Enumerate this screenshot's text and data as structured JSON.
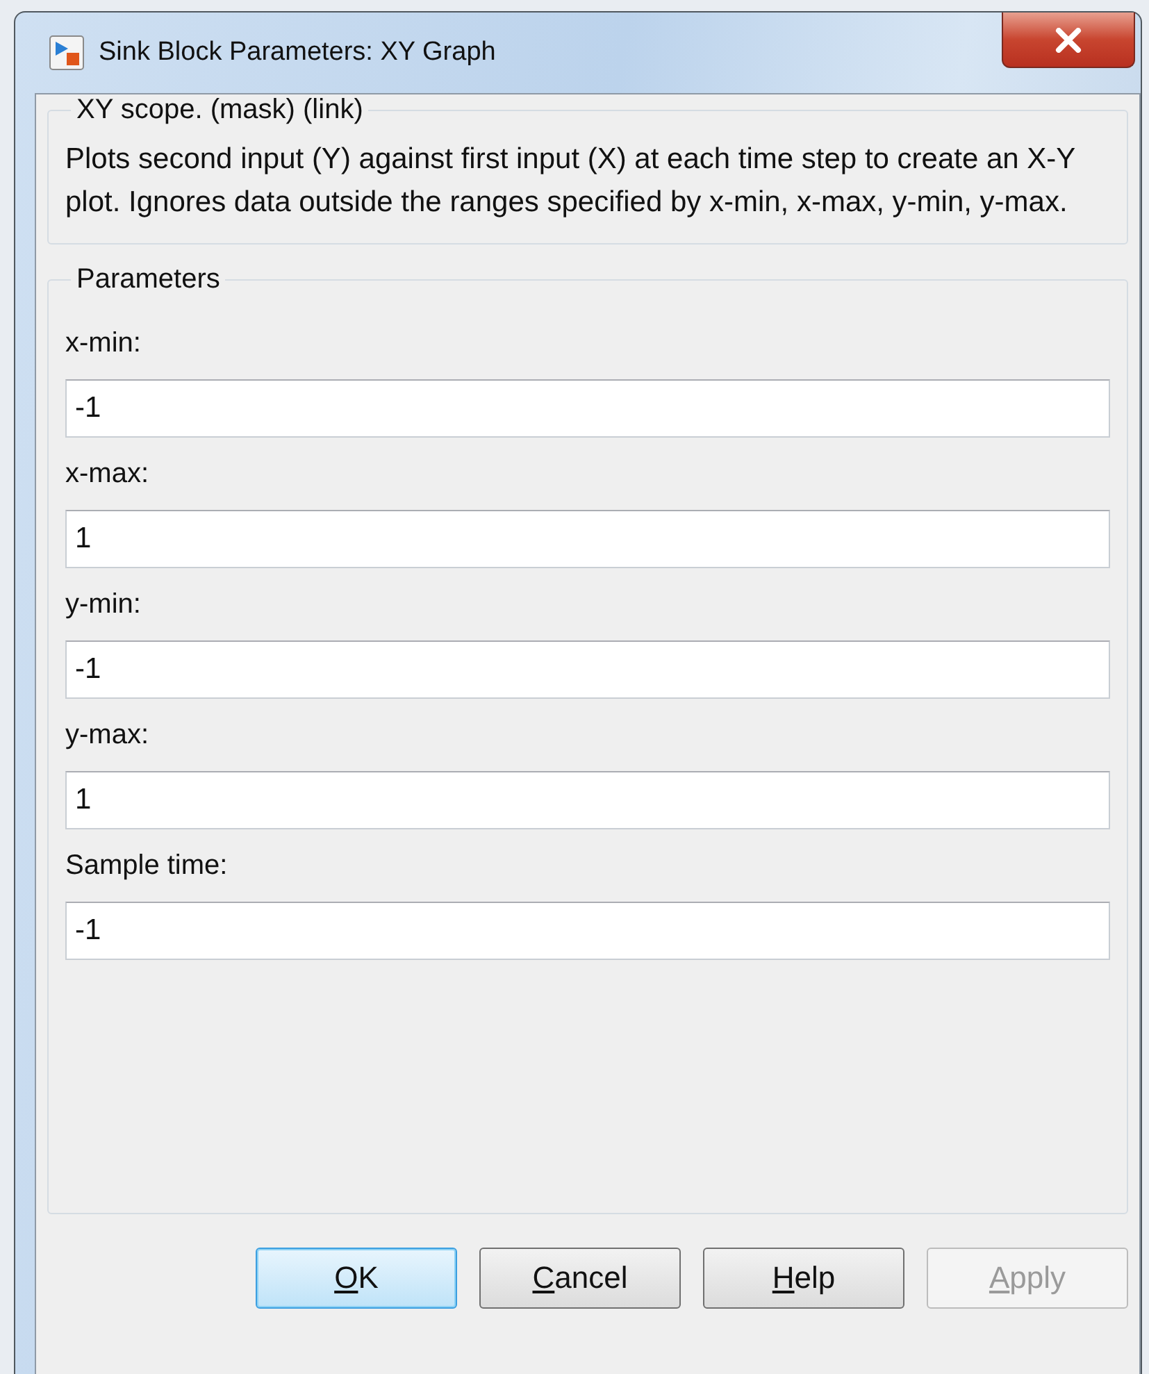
{
  "window": {
    "title": "Sink Block Parameters: XY Graph"
  },
  "description": {
    "heading": "XY scope. (mask) (link)",
    "text": "Plots second input (Y) against first input (X) at each time step to  create an X-Y plot. Ignores data outside the ranges specified by x-min, x-max, y-min, y-max."
  },
  "parameters": {
    "heading": "Parameters",
    "fields": [
      {
        "label": "x-min:",
        "value": "-1"
      },
      {
        "label": "x-max:",
        "value": "1"
      },
      {
        "label": "y-min:",
        "value": "-1"
      },
      {
        "label": "y-max:",
        "value": "1"
      },
      {
        "label": "Sample time:",
        "value": "-1"
      }
    ]
  },
  "buttons": [
    {
      "label": "OK",
      "focused": true,
      "disabled": false
    },
    {
      "label": "Cancel",
      "focused": false,
      "disabled": false
    },
    {
      "label": "Help",
      "focused": false,
      "disabled": false
    },
    {
      "label": "Apply",
      "focused": false,
      "disabled": true
    }
  ]
}
